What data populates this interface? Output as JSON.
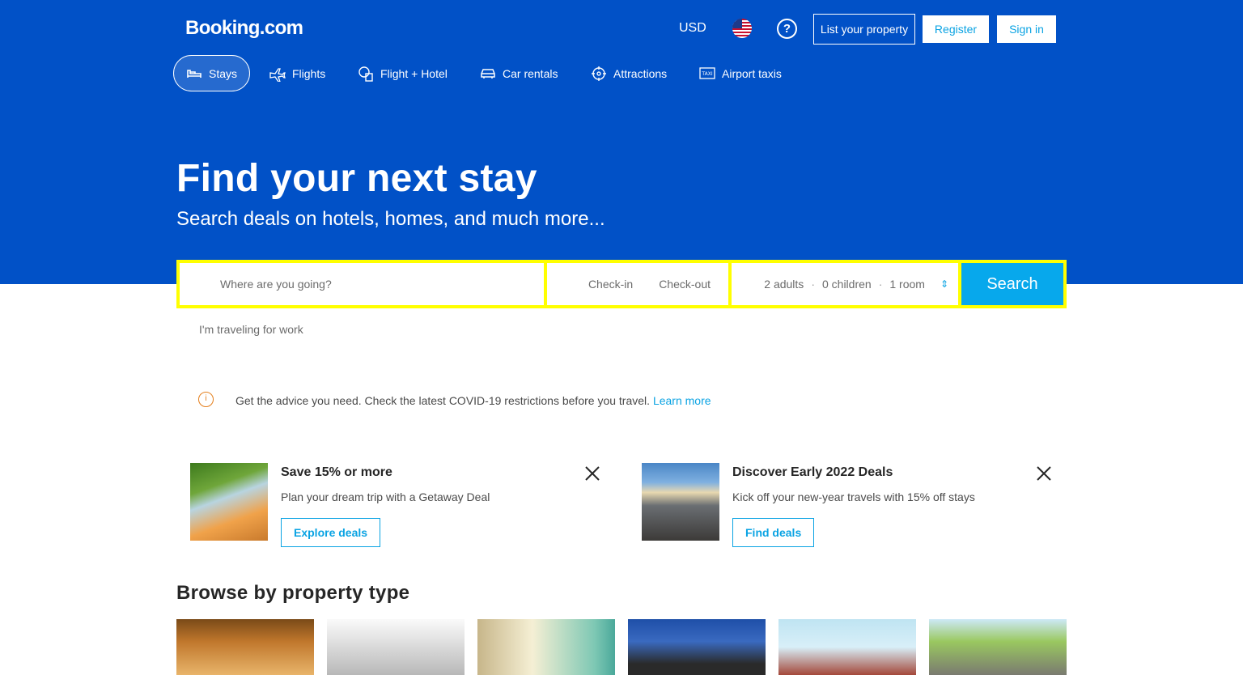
{
  "header": {
    "logo": "Booking.com",
    "currency": "USD",
    "list_property": "List your property",
    "register": "Register",
    "sign_in": "Sign in"
  },
  "nav": [
    {
      "label": "Stays",
      "icon": "bed-icon"
    },
    {
      "label": "Flights",
      "icon": "plane-icon"
    },
    {
      "label": "Flight + Hotel",
      "icon": "plane-hotel-icon"
    },
    {
      "label": "Car rentals",
      "icon": "car-icon"
    },
    {
      "label": "Attractions",
      "icon": "attractions-icon"
    },
    {
      "label": "Airport taxis",
      "icon": "taxi-icon"
    }
  ],
  "hero": {
    "title": "Find your next stay",
    "subtitle": "Search deals on hotels, homes, and much more..."
  },
  "search": {
    "destination_placeholder": "Where are you going?",
    "check_in": "Check-in",
    "check_out": "Check-out",
    "adults": "2 adults",
    "children": "0 children",
    "rooms": "1 room",
    "button": "Search",
    "work_travel": "I'm traveling for work"
  },
  "notice": {
    "text": "Get the advice you need. Check the latest COVID-19 restrictions before you travel.",
    "link": "Learn more"
  },
  "promos": [
    {
      "title": "Save 15% or more",
      "desc": "Plan your dream trip with a Getaway Deal",
      "button": "Explore deals"
    },
    {
      "title": "Discover Early 2022 Deals",
      "desc": "Kick off your new-year travels with 15% off stays",
      "button": "Find deals"
    }
  ],
  "browse": {
    "title": "Browse by property type"
  },
  "colors": {
    "brand_blue": "#0151c7",
    "accent": "#07a8ec",
    "search_border": "#ffff00"
  }
}
